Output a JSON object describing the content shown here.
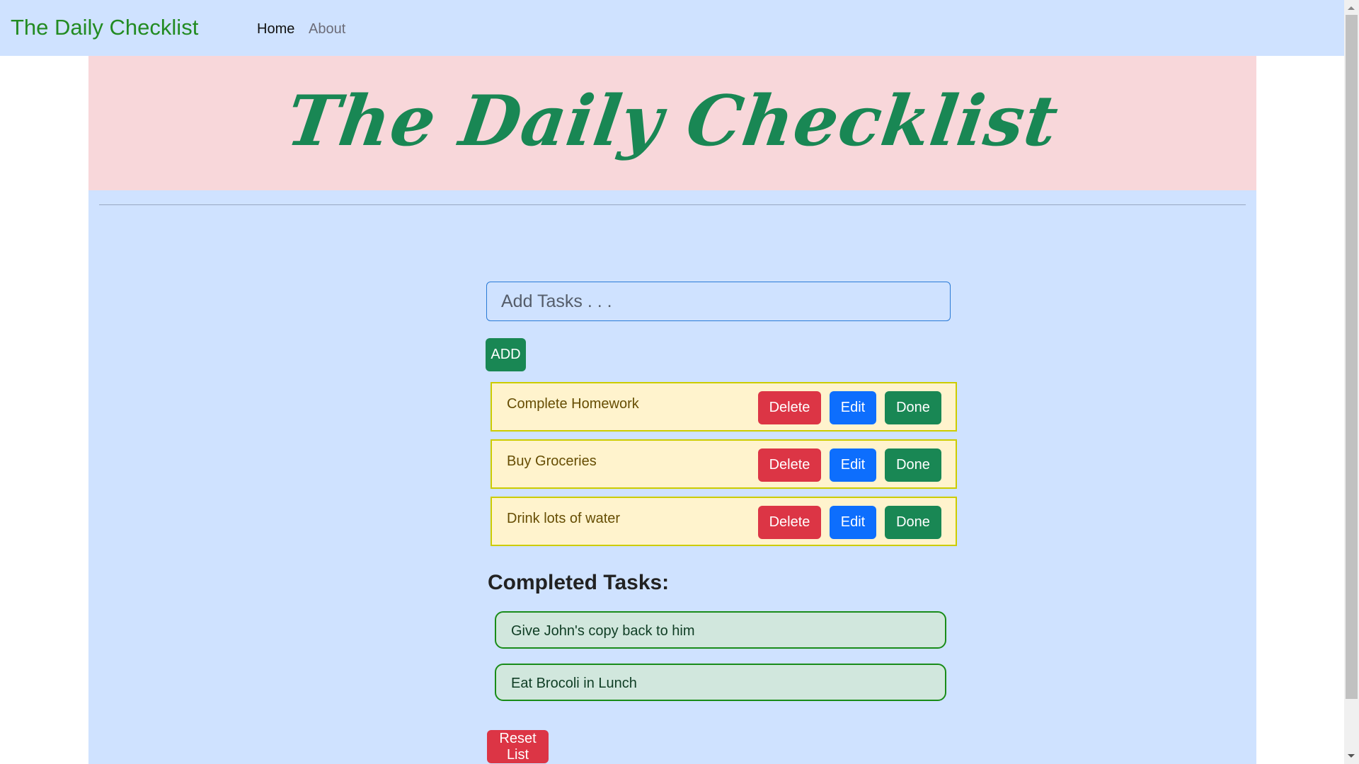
{
  "navbar": {
    "brand": "The Daily Checklist",
    "links": [
      {
        "label": "Home",
        "active": true
      },
      {
        "label": "About",
        "active": false
      }
    ]
  },
  "hero": {
    "title": "The Daily Checklist"
  },
  "form": {
    "input_placeholder": "Add Tasks . . .",
    "input_value": "",
    "add_label": "ADD"
  },
  "tasks": [
    {
      "text": "Complete Homework",
      "delete_label": "Delete",
      "edit_label": "Edit",
      "done_label": "Done"
    },
    {
      "text": "Buy Groceries",
      "delete_label": "Delete",
      "edit_label": "Edit",
      "done_label": "Done"
    },
    {
      "text": "Drink lots of water",
      "delete_label": "Delete",
      "edit_label": "Edit",
      "done_label": "Done"
    }
  ],
  "completed": {
    "heading": "Completed Tasks:",
    "items": [
      {
        "text": "Give John's copy back to him"
      },
      {
        "text": "Eat Brocoli in Lunch"
      }
    ]
  },
  "reset_label": "Reset List",
  "colors": {
    "brand": "#228b22",
    "page_bg": "#cfe2ff",
    "hero_bg": "#f8d7da",
    "hero_text": "#198754",
    "danger": "#dc3545",
    "primary": "#0d6efd",
    "success": "#198754",
    "task_bg": "#fff3cd",
    "task_border": "#cccc00",
    "completed_bg": "#d1e7dd",
    "completed_border": "#198c19"
  }
}
